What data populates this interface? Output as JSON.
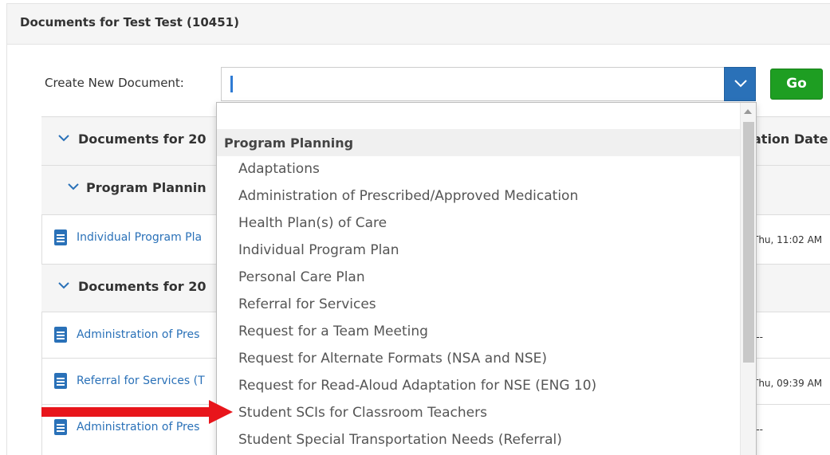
{
  "panel": {
    "title": "Documents for Test Test (10451)"
  },
  "create": {
    "label": "Create New Document:",
    "input_value": "",
    "go_label": "Go"
  },
  "grid": {
    "header_title": "Documents for 20",
    "header_date_col": "ation Date",
    "rows": [
      {
        "type": "subgroup",
        "label": "Program Plannin"
      },
      {
        "type": "doc",
        "label": "Individual Program Pla",
        "date": "Thu, 11:02 AM"
      },
      {
        "type": "group",
        "label": "Documents for 20"
      },
      {
        "type": "doc",
        "label": "Administration of Pres",
        "date": "---"
      },
      {
        "type": "doc",
        "label": "Referral for Services (T",
        "date": "Thu, 09:39 AM"
      },
      {
        "type": "doc",
        "label": "Administration of Pres",
        "date": "---"
      }
    ]
  },
  "dropdown": {
    "group": "Program Planning",
    "items": [
      "Adaptations",
      "Administration of Prescribed/Approved Medication",
      "Health Plan(s) of Care",
      "Individual Program Plan",
      "Personal Care Plan",
      "Referral for Services",
      "Request for a Team Meeting",
      "Request for Alternate Formats (NSA and NSE)",
      "Request for Read-Aloud Adaptation for NSE (ENG 10)",
      "Student SCIs for Classroom Teachers",
      "Student Special Transportation Needs (Referral)"
    ]
  },
  "colors": {
    "accent": "#2a71b8",
    "go": "#1e9e22",
    "annotation_arrow": "#e8151b"
  },
  "icons": {
    "document": "document-icon",
    "chevron": "chevron-down-icon"
  }
}
